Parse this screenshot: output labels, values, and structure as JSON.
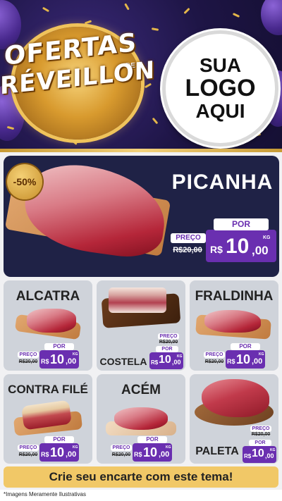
{
  "header": {
    "title_line1": "OFERTAS",
    "title_de": "DE",
    "title_line2": "RÉVEILLON",
    "logo_line1": "SUA",
    "logo_line2": "LOGO",
    "logo_line3": "AQUI"
  },
  "featured": {
    "discount": "-50%",
    "name": "PICANHA",
    "preco_label": "PREÇO",
    "old_price": "R$20,00",
    "por_label": "POR",
    "currency": "R$",
    "price_int": "10",
    "price_cents": ",00",
    "unit": "KG"
  },
  "products": [
    {
      "name": "ALCATRA",
      "preco_label": "PREÇO",
      "old_price": "R$20,00",
      "por_label": "POR",
      "currency": "R$",
      "price_int": "10",
      "price_cents": ",00",
      "unit": "KG"
    },
    {
      "name": "COSTELA",
      "preco_label": "PREÇO",
      "old_price": "R$20,00",
      "por_label": "POR",
      "currency": "R$",
      "price_int": "10",
      "price_cents": ",00",
      "unit": "KG"
    },
    {
      "name": "FRALDINHA",
      "preco_label": "PREÇO",
      "old_price": "R$20,00",
      "por_label": "POR",
      "currency": "R$",
      "price_int": "10",
      "price_cents": ",00",
      "unit": "KG"
    },
    {
      "name": "CONTRA FILÉ",
      "preco_label": "PREÇO",
      "old_price": "R$20,00",
      "por_label": "POR",
      "currency": "R$",
      "price_int": "10",
      "price_cents": ",00",
      "unit": "KG"
    },
    {
      "name": "ACÉM",
      "preco_label": "PREÇO",
      "old_price": "R$20,00",
      "por_label": "POR",
      "currency": "R$",
      "price_int": "10",
      "price_cents": ",00",
      "unit": "KG"
    },
    {
      "name": "PALETA",
      "preco_label": "PREÇO",
      "old_price": "R$20,00",
      "por_label": "POR",
      "currency": "R$",
      "price_int": "10",
      "price_cents": ",00",
      "unit": "KG"
    }
  ],
  "cta": "Crie seu encarte com este tema!",
  "footnote": "*Imagens Meramente Ilustrativas",
  "colors": {
    "accent": "#6a2fb0",
    "header_bg": "#1e1546",
    "gold": "#e3b64a",
    "featured_bg": "#1f2246",
    "cta_bg": "#f1c867"
  }
}
